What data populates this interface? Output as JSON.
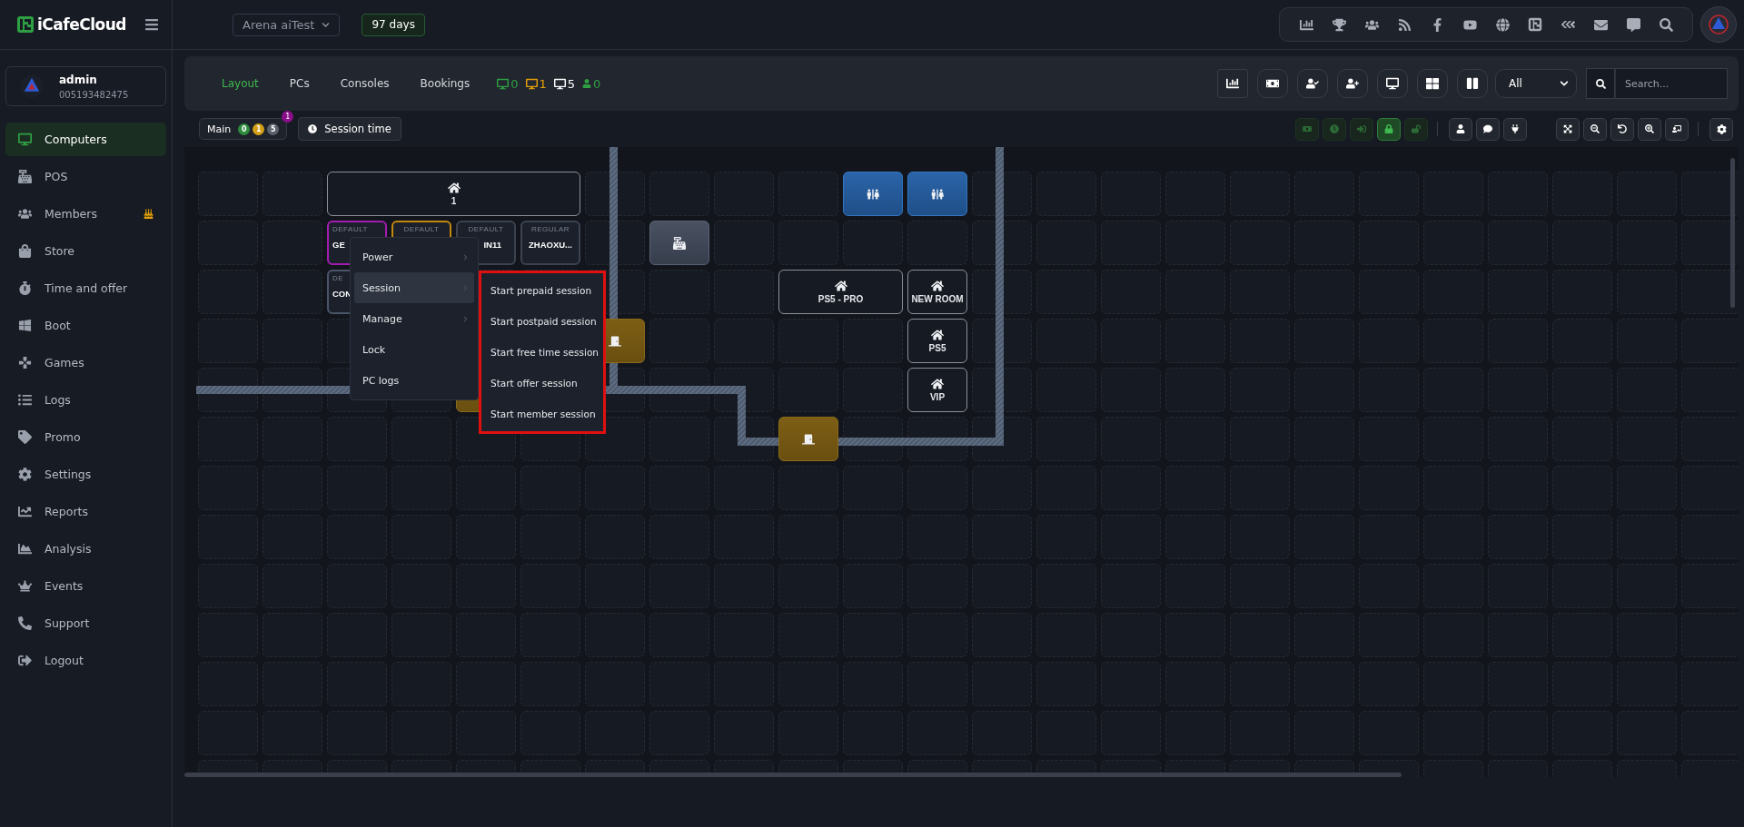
{
  "app": {
    "name": "iCafeCloud"
  },
  "branch": {
    "value": "Arena aiTest"
  },
  "license": {
    "text": "97 days"
  },
  "user": {
    "name": "admin",
    "id": "005193482475"
  },
  "sidebar": {
    "items": [
      {
        "label": "Computers",
        "selected": true
      },
      {
        "label": "POS",
        "selected": false
      },
      {
        "label": "Members",
        "selected": false
      },
      {
        "label": "Store",
        "selected": false
      },
      {
        "label": "Time and offer",
        "selected": false
      },
      {
        "label": "Boot",
        "selected": false
      },
      {
        "label": "Games",
        "selected": false
      },
      {
        "label": "Logs",
        "selected": false
      },
      {
        "label": "Promo",
        "selected": false
      },
      {
        "label": "Settings",
        "selected": false
      },
      {
        "label": "Reports",
        "selected": false
      },
      {
        "label": "Analysis",
        "selected": false
      },
      {
        "label": "Events",
        "selected": false
      },
      {
        "label": "Support",
        "selected": false
      },
      {
        "label": "Logout",
        "selected": false
      }
    ]
  },
  "tabs": [
    {
      "label": "Layout",
      "selected": true
    },
    {
      "label": "PCs",
      "selected": false
    },
    {
      "label": "Consoles",
      "selected": false
    },
    {
      "label": "Bookings",
      "selected": false
    }
  ],
  "counters": [
    {
      "kind": "monitor",
      "count": "0",
      "color": "#2ea043"
    },
    {
      "kind": "monitor",
      "count": "1",
      "color": "#e3a008"
    },
    {
      "kind": "monitor",
      "count": "5",
      "color": "#ffffff"
    },
    {
      "kind": "person",
      "count": "0",
      "color": "#2ea043"
    }
  ],
  "filter": {
    "value": "All"
  },
  "search": {
    "placeholder": "Search..."
  },
  "room_tab": {
    "label": "Main",
    "notification": "1",
    "counts": [
      {
        "count": "0",
        "color": "#2e8b3e"
      },
      {
        "count": "1",
        "color": "#d4a017"
      },
      {
        "count": "5",
        "color": "#5a616c"
      }
    ]
  },
  "session_time_button": {
    "label": "Session time"
  },
  "lock_tools": [
    {
      "active": false
    },
    {
      "active": false
    },
    {
      "active": false
    },
    {
      "active": true
    },
    {
      "active": false
    }
  ],
  "canvas": {
    "items": [
      {
        "kind": "room",
        "name": "1"
      },
      {
        "kind": "pc",
        "group": "DEFAULT",
        "name": "GE",
        "color": "#a21caf"
      },
      {
        "kind": "pc",
        "group": "DEFAULT",
        "color": "#c2870f"
      },
      {
        "kind": "pc",
        "group": "DEFAULT",
        "name": "IN11",
        "color": "#3b4250"
      },
      {
        "kind": "pc",
        "group": "REGULAR",
        "name": "ZHAOXU...",
        "color": "#3b4250"
      },
      {
        "kind": "pc",
        "group": "DE",
        "name": "CON",
        "color": "#4a5568"
      },
      {
        "kind": "door"
      },
      {
        "kind": "blank"
      },
      {
        "kind": "register"
      },
      {
        "kind": "toilet"
      },
      {
        "kind": "toilet"
      },
      {
        "kind": "room",
        "name": "PS5 - PRO"
      },
      {
        "kind": "room",
        "name": "NEW ROOM"
      },
      {
        "kind": "room",
        "name": "PS5"
      },
      {
        "kind": "room",
        "name": "VIP"
      },
      {
        "kind": "door"
      }
    ]
  },
  "context_menu": {
    "items": [
      {
        "label": "Power",
        "selected": false,
        "submenu": true
      },
      {
        "label": "Session",
        "selected": true,
        "submenu": true
      },
      {
        "label": "Manage",
        "selected": false,
        "submenu": true
      },
      {
        "label": "Lock",
        "selected": false,
        "submenu": false
      },
      {
        "label": "PC logs",
        "selected": false,
        "submenu": false
      }
    ]
  },
  "session_menu": {
    "items": [
      {
        "label": "Start prepaid session"
      },
      {
        "label": "Start postpaid session"
      },
      {
        "label": "Start free time session"
      },
      {
        "label": "Start offer session"
      },
      {
        "label": "Start member session"
      }
    ]
  }
}
